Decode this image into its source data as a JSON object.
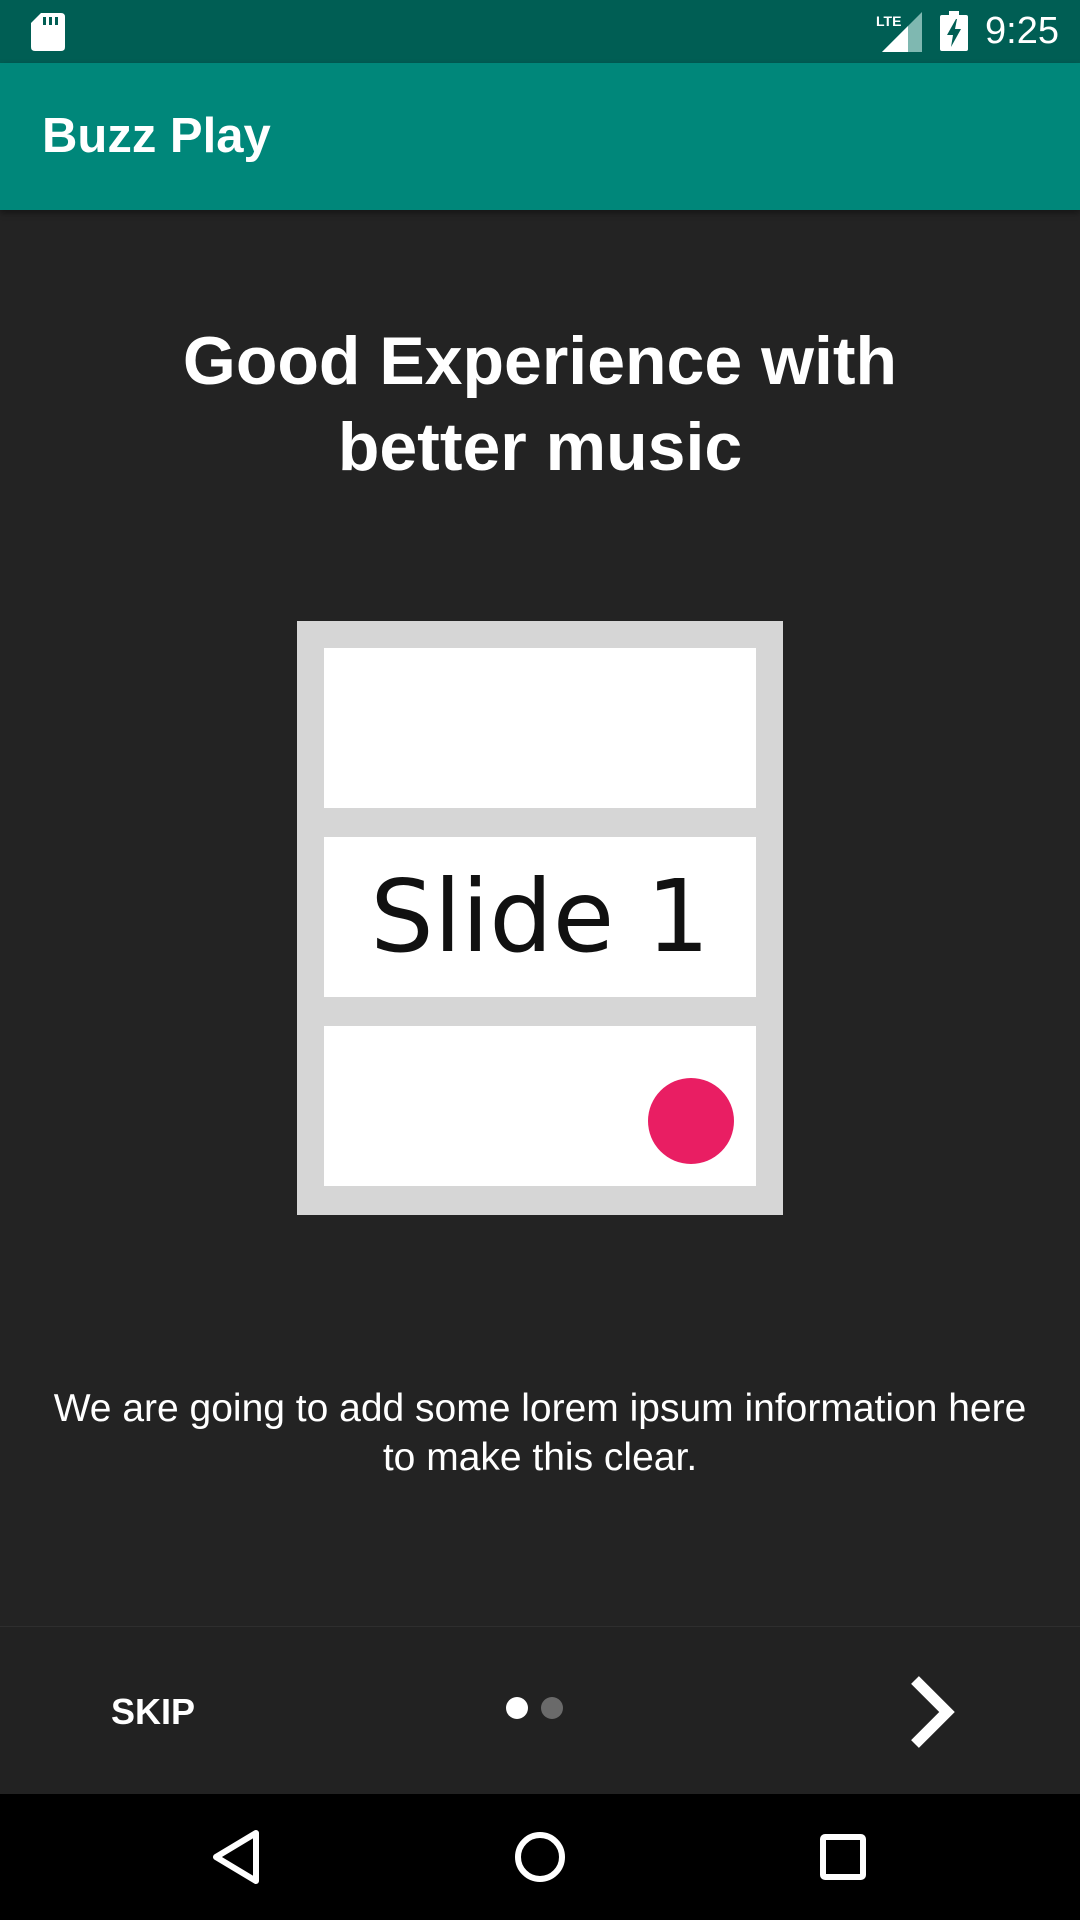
{
  "status_bar": {
    "time": "9:25",
    "network_label": "LTE",
    "icons": [
      "sd-card-icon",
      "lte-signal-icon",
      "battery-charging-icon"
    ]
  },
  "app_bar": {
    "title": "Buzz Play",
    "color": "#00877a",
    "status_color": "#005e54"
  },
  "intro": {
    "headline": "Good Experience with better music",
    "slide_label": "Slide 1",
    "description": "We are going to add some lorem ipsum information here to make this clear.",
    "skip_label": "SKIP",
    "page_count": 2,
    "current_page": 1,
    "next_icon": "chevron-right-icon",
    "accent_color": "#e91e63",
    "background_color": "#232323"
  },
  "nav_bar": {
    "icons": [
      "back-triangle-icon",
      "home-circle-icon",
      "recents-square-icon"
    ]
  }
}
